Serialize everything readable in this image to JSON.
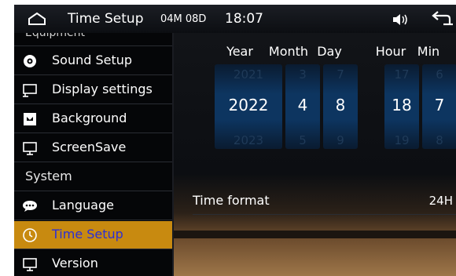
{
  "header": {
    "title": "Time Setup",
    "date_info": "04M 08D",
    "clock": "18:07",
    "icons": [
      "home-icon",
      "volume-icon",
      "back-icon"
    ]
  },
  "sidebar": {
    "partial_label": "Equipment",
    "items": [
      {
        "label": "Sound Setup",
        "icon": "sound-icon"
      },
      {
        "label": "Display settings",
        "icon": "display-icon"
      },
      {
        "label": "Background",
        "icon": "background-icon"
      },
      {
        "label": "ScreenSave",
        "icon": "screensave-icon"
      },
      {
        "label": "System",
        "type": "header"
      },
      {
        "label": "Language",
        "icon": "language-icon"
      },
      {
        "label": "Time Setup",
        "icon": "clock-icon",
        "active": true
      },
      {
        "label": "Version",
        "icon": "version-icon"
      }
    ]
  },
  "time_picker": {
    "columns": [
      {
        "label": "Year",
        "prev": "2021",
        "value": "2022",
        "next": "2023"
      },
      {
        "label": "Month",
        "prev": "3",
        "value": "4",
        "next": "5"
      },
      {
        "label": "Day",
        "prev": "7",
        "value": "8",
        "next": "9"
      },
      {
        "label": "Hour",
        "prev": "17",
        "value": "18",
        "next": "19"
      },
      {
        "label": "Min",
        "prev": "6",
        "value": "7",
        "next": "8"
      }
    ]
  },
  "time_format": {
    "label": "Time format",
    "value": "24H"
  },
  "colors": {
    "active_bg": "#c88a10",
    "active_text": "#2b2fd6",
    "picker_blue": "#0d3560"
  }
}
